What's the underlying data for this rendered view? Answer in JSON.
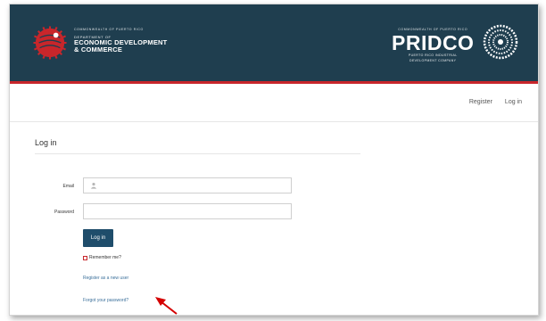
{
  "header": {
    "ddec_line1": "COMMONWEALTH OF PUERTO RICO",
    "ddec_line2": "DEPARTMENT OF",
    "ddec_line3": "ECONOMIC DEVELOPMENT",
    "ddec_line4": "& COMMERCE",
    "pridco_top": "COMMONWEALTH OF PUERTO RICO",
    "pridco_name": "PRIDCO",
    "pridco_sub1": "PUERTO RICO INDUSTRIAL",
    "pridco_sub2": "DEVELOPMENT COMPANY"
  },
  "nav": {
    "register": "Register",
    "login": "Log in"
  },
  "page": {
    "title": "Log in"
  },
  "form": {
    "email_label": "Email",
    "password_label": "Password",
    "email_value": "",
    "password_value": "",
    "submit_label": "Log in",
    "remember_label": "Remember me?",
    "register_link": "Register as a new user",
    "forgot_link": "Forgot your password?"
  },
  "colors": {
    "banner": "#1f3e4f",
    "accent_red": "#c8262b",
    "button": "#1f4d6b",
    "link": "#3a6f9a"
  },
  "icons": {
    "ddec_logo": "ddec-seal-icon",
    "pridco_logo": "pridco-globe-icon",
    "email_field_icon": "user-icon",
    "annotation": "red-arrow-icon"
  }
}
